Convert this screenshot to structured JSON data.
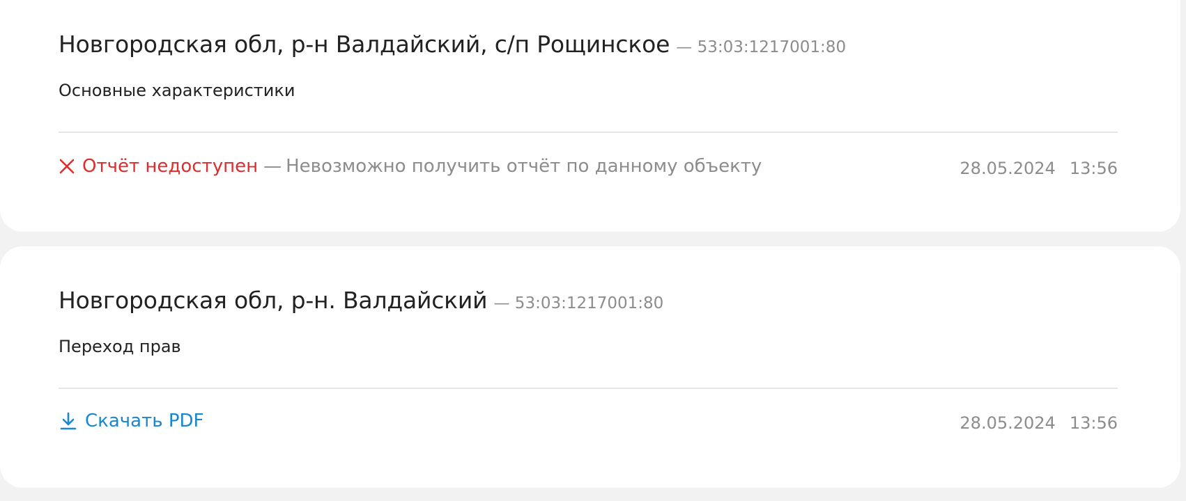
{
  "records": [
    {
      "address": "Новгородская обл, р-н Валдайский, с/п Рощинское",
      "cadastral_number": "— 53:03:1217001:80",
      "report_type": "Основные характеристики",
      "status": {
        "icon": "close-icon",
        "label": "Отчёт недоступен",
        "separator": "—",
        "description": "Невозможно получить отчёт по данному объекту",
        "color": "#e02c2c"
      },
      "date": "28.05.2024",
      "time": "13:56"
    },
    {
      "address": "Новгородская обл, р-н. Валдайский",
      "cadastral_number": "— 53:03:1217001:80",
      "report_type": "Переход прав",
      "download": {
        "icon": "download-icon",
        "label": "Скачать PDF",
        "color": "#1a86d0"
      },
      "date": "28.05.2024",
      "time": "13:56"
    }
  ]
}
